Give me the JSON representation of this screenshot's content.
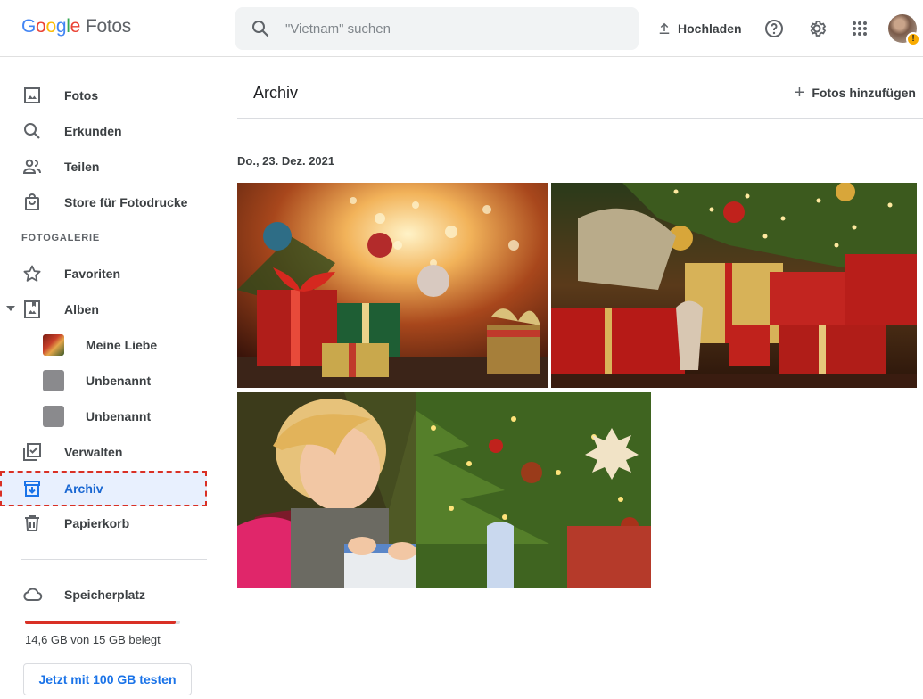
{
  "header": {
    "logo_google": [
      "G",
      "o",
      "o",
      "g",
      "l",
      "e"
    ],
    "logo_product": "Fotos",
    "search_placeholder": "\"Vietnam\" suchen",
    "upload_label": "Hochladen"
  },
  "sidebar": {
    "items": [
      {
        "label": "Fotos",
        "icon": "photo-icon"
      },
      {
        "label": "Erkunden",
        "icon": "search-icon"
      },
      {
        "label": "Teilen",
        "icon": "people-icon"
      },
      {
        "label": "Store für Fotodrucke",
        "icon": "shopping-bag-icon"
      }
    ],
    "section_label": "FOTOGALERIE",
    "library": [
      {
        "label": "Favoriten",
        "icon": "star-icon"
      },
      {
        "label": "Alben",
        "icon": "album-icon"
      }
    ],
    "albums": [
      {
        "label": "Meine Liebe"
      },
      {
        "label": "Unbenannt"
      },
      {
        "label": "Unbenannt"
      }
    ],
    "more": [
      {
        "label": "Verwalten",
        "icon": "manage-icon"
      },
      {
        "label": "Archiv",
        "icon": "archive-icon",
        "active": true
      },
      {
        "label": "Papierkorb",
        "icon": "trash-icon"
      }
    ],
    "storage": {
      "label": "Speicherplatz",
      "usage_text": "14,6 GB von 15 GB belegt",
      "used_fraction": 0.973,
      "try_button": "Jetzt mit 100 GB testen"
    }
  },
  "main": {
    "title": "Archiv",
    "add_photos_label": "Fotos hinzufügen",
    "date_label": "Do., 23. Dez. 2021",
    "photos": [
      {
        "alt": "christmas-gifts-bokeh"
      },
      {
        "alt": "gifts-under-tree"
      },
      {
        "alt": "girl-opening-present"
      }
    ]
  },
  "colors": {
    "accent": "#1a73e8",
    "active_bg": "#e8f0fe",
    "highlight_border": "#d93025",
    "storage_fill": "#d93025"
  }
}
